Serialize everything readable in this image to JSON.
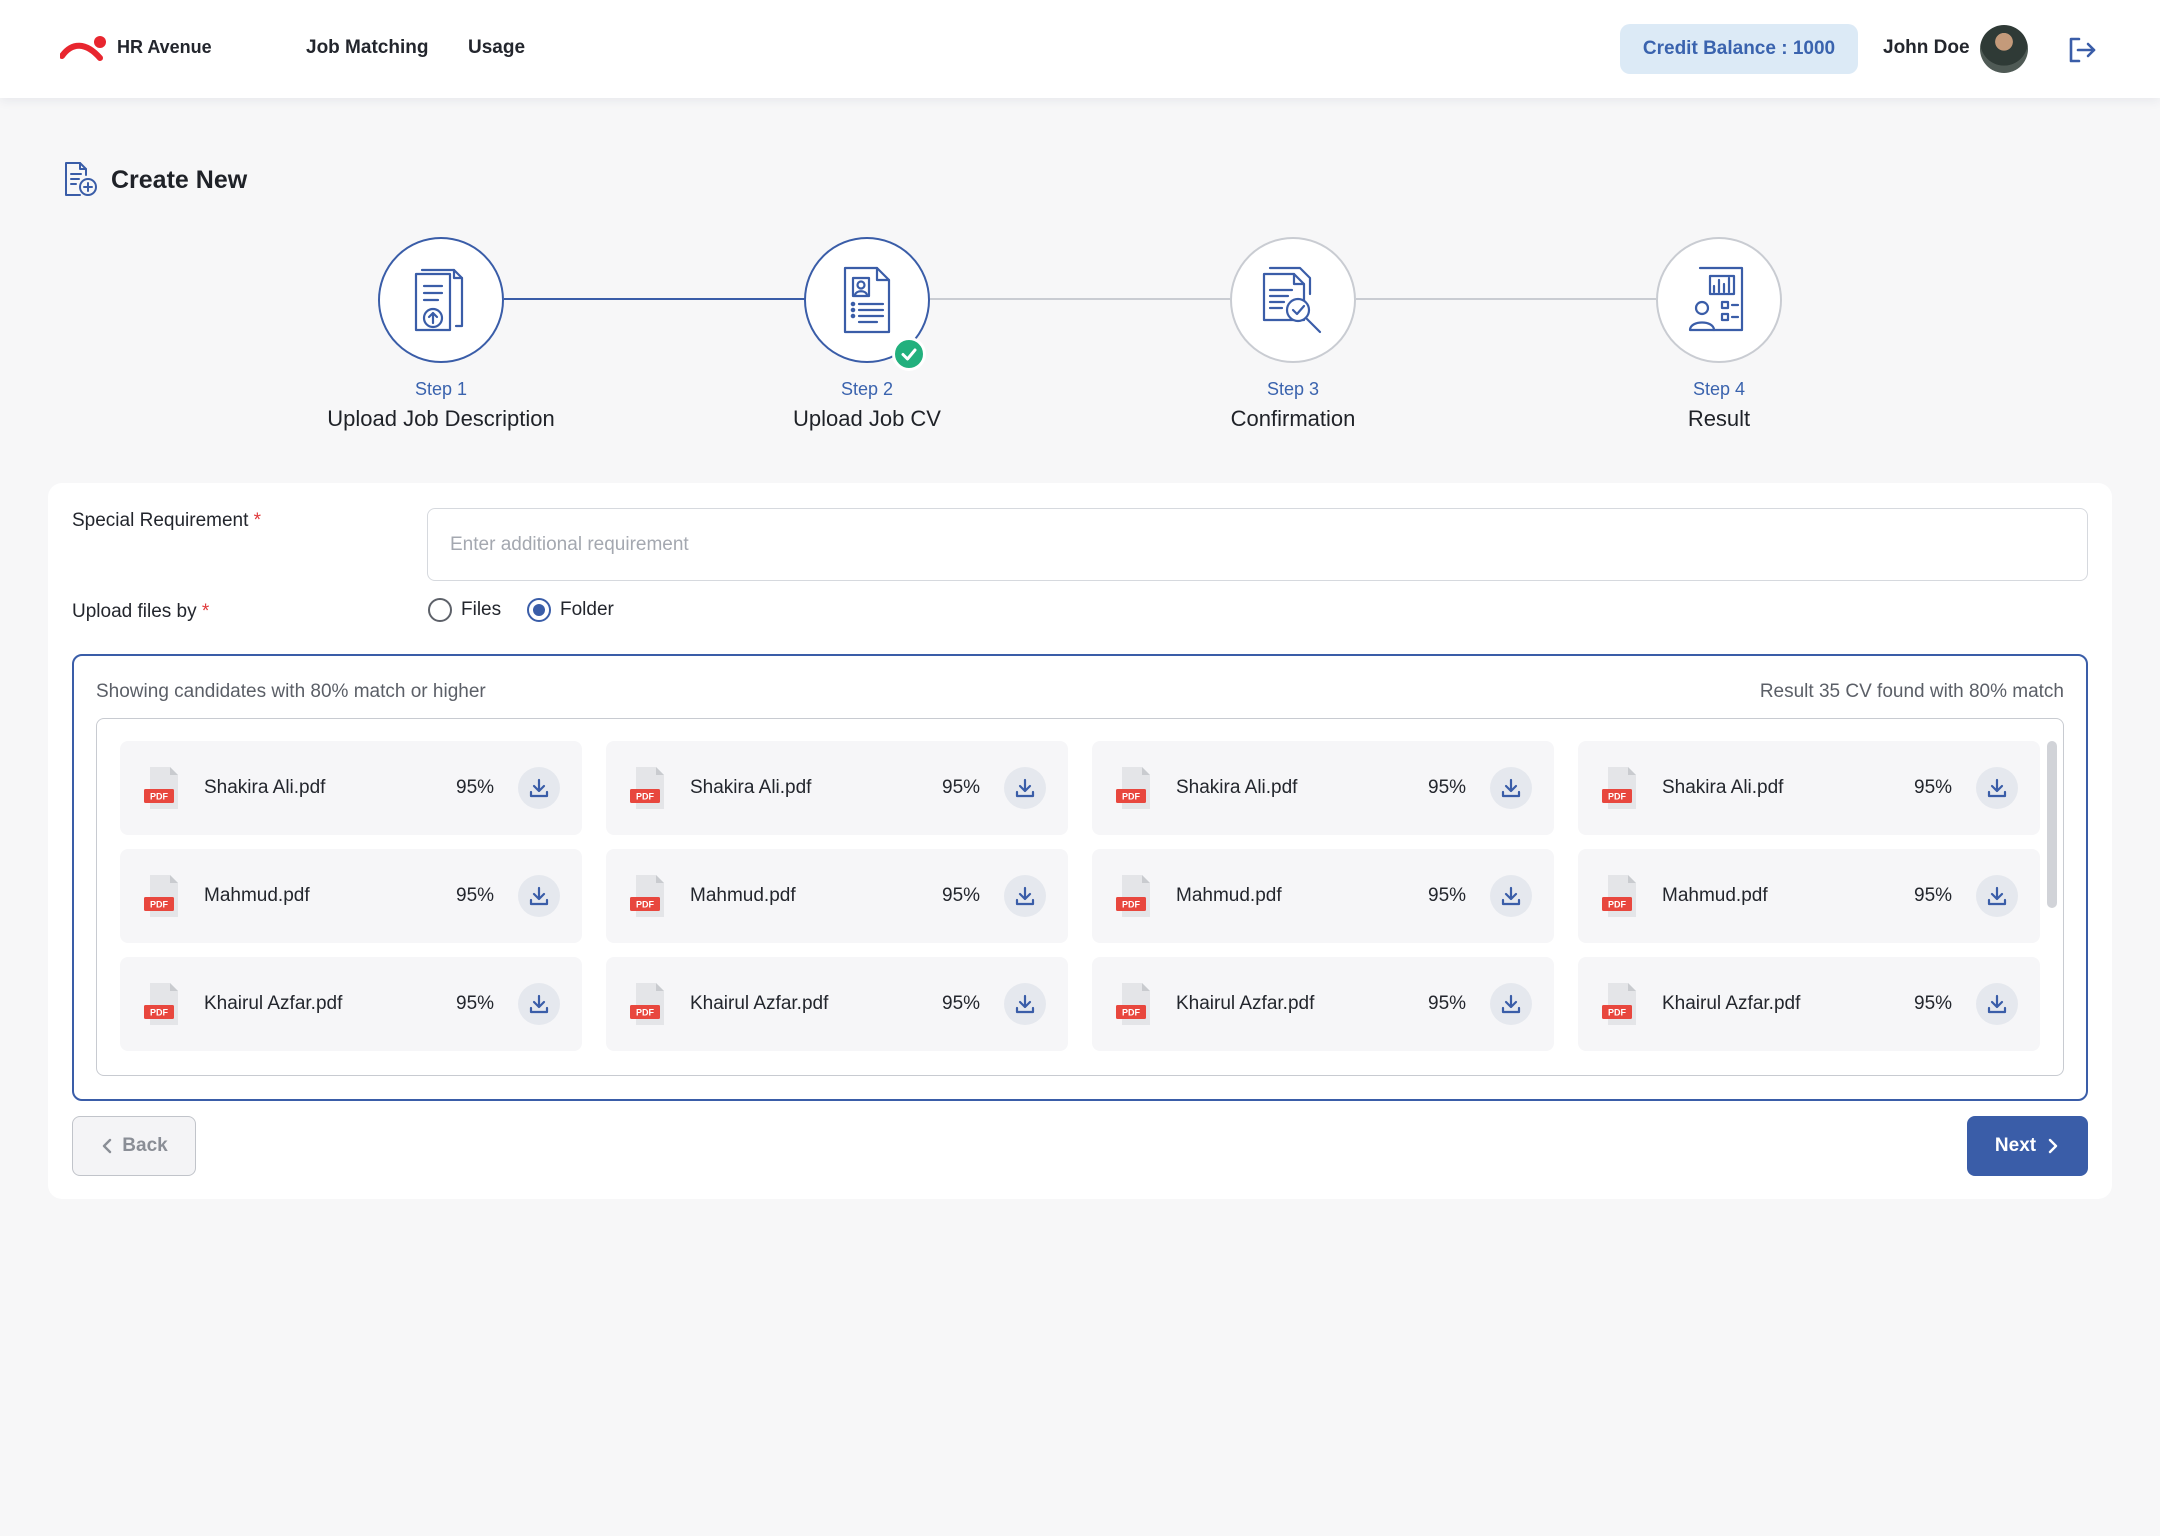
{
  "header": {
    "brand": "HR Avenue",
    "nav": [
      "Job Matching",
      "Usage"
    ],
    "credit": "Credit Balance : 1000",
    "user_name": "John Doe"
  },
  "page_title": "Create New",
  "steps": [
    {
      "label": "Step 1",
      "title": "Upload Job Description",
      "icon": "upload-document-icon",
      "status": "done"
    },
    {
      "label": "Step 2",
      "title": "Upload Job CV",
      "icon": "cv-document-icon",
      "status": "current"
    },
    {
      "label": "Step 3",
      "title": "Confirmation",
      "icon": "document-search-icon",
      "status": "pending"
    },
    {
      "label": "Step 4",
      "title": "Result",
      "icon": "report-chart-icon",
      "status": "pending"
    }
  ],
  "form": {
    "special_label": "Special Requirement",
    "required_mark": "*",
    "special_placeholder": "Enter additional requirement",
    "special_value": "",
    "upload_label": "Upload files by",
    "upload_options": [
      "Files",
      "Folder"
    ],
    "upload_selected": "Folder"
  },
  "results": {
    "left_text": "Showing candidates with 80% match or higher",
    "right_text": "Result 35 CV found with 80% match",
    "files": [
      [
        {
          "name": "Shakira Ali.pdf",
          "match": "95%"
        },
        {
          "name": "Shakira Ali.pdf",
          "match": "95%"
        },
        {
          "name": "Shakira Ali.pdf",
          "match": "95%"
        },
        {
          "name": "Shakira Ali.pdf",
          "match": "95%"
        }
      ],
      [
        {
          "name": "Mahmud.pdf",
          "match": "95%"
        },
        {
          "name": "Mahmud.pdf",
          "match": "95%"
        },
        {
          "name": "Mahmud.pdf",
          "match": "95%"
        },
        {
          "name": "Mahmud.pdf",
          "match": "95%"
        }
      ],
      [
        {
          "name": "Khairul Azfar.pdf",
          "match": "95%"
        },
        {
          "name": "Khairul Azfar.pdf",
          "match": "95%"
        },
        {
          "name": "Khairul Azfar.pdf",
          "match": "95%"
        },
        {
          "name": "Khairul Azfar.pdf",
          "match": "95%"
        }
      ]
    ],
    "pdf_badge": "PDF"
  },
  "buttons": {
    "back": "Back",
    "next": "Next"
  },
  "colors": {
    "primary": "#3a5da8",
    "credit_bg": "#dceaf6",
    "success": "#22b07d",
    "pdf_red": "#e8473e",
    "logo_red": "#e8262f"
  }
}
